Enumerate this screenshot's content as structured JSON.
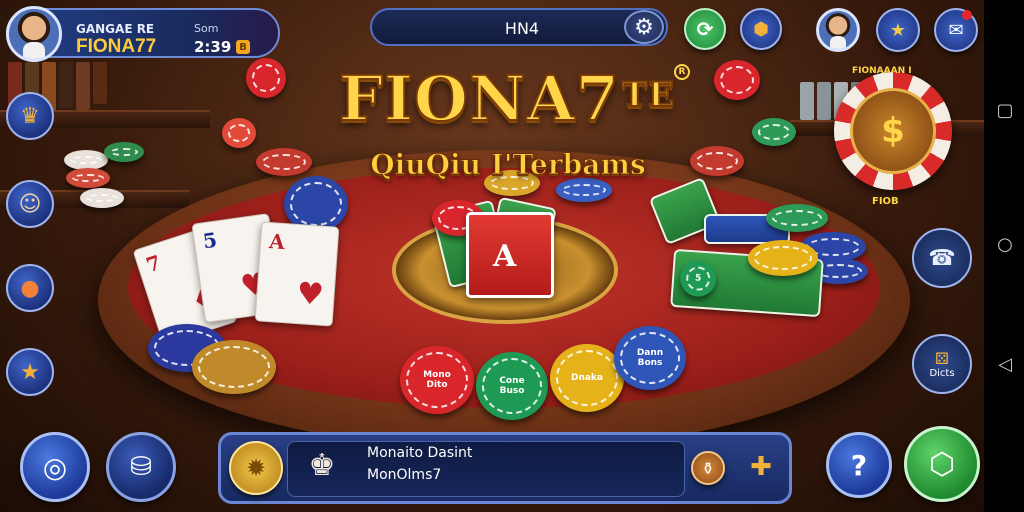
{
  "player": {
    "label": "GANGAE RE",
    "name": "FIONA77",
    "sublabel": "Som",
    "time": "2:39",
    "coin_glyph": "B"
  },
  "top_bar": {
    "center_text": "HN4",
    "settings_icon": "gear-icon"
  },
  "logo": {
    "title": "FIONA7",
    "title_badge": "TE",
    "registered": "R",
    "subtitle": "QiuQiu I'Terbams"
  },
  "banner_chip": {
    "top_text": "FIONAAAN I",
    "bottom_text": "FIOB"
  },
  "table": {
    "cards": [
      {
        "rank": "7",
        "suit": "♦"
      },
      {
        "rank": "5",
        "suit": "♥"
      },
      {
        "rank": "A",
        "suit": "♥"
      }
    ],
    "center_card_text": "A",
    "green_card_chip_text": "5",
    "chips": [
      {
        "text": "Mono Dito",
        "color": "#d8262b"
      },
      {
        "text": "Cone Buso",
        "color": "#1f9a55"
      },
      {
        "text": "Dnaka",
        "color": "#e6b21a"
      },
      {
        "text": "Dann Bons",
        "color": "#2e56b8"
      }
    ]
  },
  "right_side": {
    "btn2_label": "Dicts"
  },
  "bottom": {
    "title": "Monaito Dasint",
    "subtitle": "MonOlms7"
  },
  "colors": {
    "accent_gold": "#ffd54a",
    "panel_blue": "#2a3f86",
    "felt_red": "#b32a22",
    "play_green": "#2fae3c"
  }
}
